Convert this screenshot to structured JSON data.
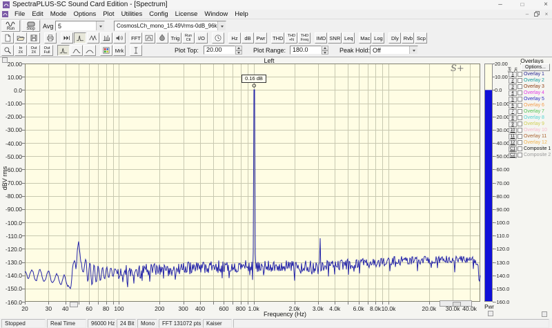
{
  "window": {
    "title": "SpectraPLUS-SC Sound Card Edition - [Spectrum]"
  },
  "menu": {
    "items": [
      "File",
      "Edit",
      "Mode",
      "Options",
      "Plot",
      "Utilities",
      "Config",
      "License",
      "Window",
      "Help"
    ]
  },
  "transport": {
    "run": "Run",
    "stop": "Stop",
    "avg_label": "Avg",
    "avg_value": "5",
    "source_value": "CosmosLCh_mono_15.49Vrms-0dB_96k"
  },
  "toolbar_buttons": [
    {
      "type": "icon",
      "name": "new-document"
    },
    {
      "type": "icon",
      "name": "open-folder"
    },
    {
      "type": "icon",
      "name": "save"
    },
    {
      "type": "gap"
    },
    {
      "type": "icon",
      "name": "print"
    },
    {
      "type": "gap"
    },
    {
      "type": "icon",
      "name": "time-series"
    },
    {
      "type": "icon",
      "name": "spectrum",
      "pressed": true
    },
    {
      "type": "icon",
      "name": "waveform"
    },
    {
      "type": "icon",
      "name": "3d-surface"
    },
    {
      "type": "icon",
      "name": "audio-levels"
    },
    {
      "type": "gap"
    },
    {
      "type": "text",
      "label": "FFT",
      "name": "fft"
    },
    {
      "type": "icon",
      "name": "oscilloscope"
    },
    {
      "type": "icon",
      "name": "spectrogram"
    },
    {
      "type": "text",
      "label": "Trig",
      "name": "trigger"
    },
    {
      "type": "text2",
      "label": "Run|Ctl",
      "name": "run-control"
    },
    {
      "type": "text",
      "label": "I/O",
      "name": "io"
    },
    {
      "type": "gap"
    },
    {
      "type": "icon",
      "name": "clock"
    },
    {
      "type": "gap"
    },
    {
      "type": "text",
      "label": "Hz",
      "name": "hz"
    },
    {
      "type": "text",
      "label": "dB",
      "name": "db"
    },
    {
      "type": "text",
      "label": "Pwr",
      "name": "pwr"
    },
    {
      "type": "gap"
    },
    {
      "type": "text",
      "label": "THD",
      "name": "thd"
    },
    {
      "type": "text2",
      "label": "THD|+N",
      "name": "thd-n"
    },
    {
      "type": "text2",
      "label": "THD|Freq",
      "name": "thd-freq"
    },
    {
      "type": "gap"
    },
    {
      "type": "text",
      "label": "IMD",
      "name": "imd"
    },
    {
      "type": "text",
      "label": "SNR",
      "name": "snr"
    },
    {
      "type": "text",
      "label": "Leq",
      "name": "leq"
    },
    {
      "type": "gap"
    },
    {
      "type": "text",
      "label": "Mac",
      "name": "macro"
    },
    {
      "type": "text",
      "label": "Log",
      "name": "log"
    },
    {
      "type": "gap"
    },
    {
      "type": "text",
      "label": "Dly",
      "name": "delay"
    },
    {
      "type": "text",
      "label": "Rvb",
      "name": "reverb"
    },
    {
      "type": "text",
      "label": "Scp",
      "name": "scope"
    }
  ],
  "zoom_buttons": [
    {
      "type": "icon",
      "name": "magnifier"
    },
    {
      "type": "text2",
      "label": "In|2X",
      "name": "zoom-in-2x"
    },
    {
      "type": "text2",
      "label": "Out|2X",
      "name": "zoom-out-2x"
    },
    {
      "type": "text2",
      "label": "Out|Full",
      "name": "zoom-out-full"
    },
    {
      "type": "gap"
    },
    {
      "type": "icon",
      "name": "peak-narrow",
      "pressed": true
    },
    {
      "type": "icon",
      "name": "peak-medium"
    },
    {
      "type": "icon",
      "name": "peak-wide"
    },
    {
      "type": "gap"
    },
    {
      "type": "icon",
      "name": "legend-colors"
    },
    {
      "type": "text",
      "label": "Mrk",
      "name": "marker"
    },
    {
      "type": "gap"
    },
    {
      "type": "icon",
      "name": "marker-ibeam"
    }
  ],
  "plot_controls": {
    "plot_top_label": "Plot Top:",
    "plot_top_value": "20.00",
    "plot_range_label": "Plot Range:",
    "plot_range_value": "180.0",
    "peak_hold_label": "Peak Hold:",
    "peak_hold_value": "Off"
  },
  "plot": {
    "channel": "Left",
    "logo": "S+",
    "ylabel": "dBV rms",
    "xlabel": "Frequency (Hz)",
    "y_tick_labels": [
      "20.00",
      "10.00",
      "0.0",
      "-10.00",
      "-20.00",
      "-30.00",
      "-40.00",
      "-50.00",
      "-60.00",
      "-70.00",
      "-80.00",
      "-90.00",
      "-100.0",
      "-110.0",
      "-120.0",
      "-130.0",
      "-140.0",
      "-150.0",
      "-160.0"
    ],
    "marker_value": "0.16 dB"
  },
  "meter": {
    "label": "Pwr"
  },
  "overlays": {
    "title": "Overlays",
    "col_sel": "Sel",
    "col_on": "On",
    "options": "Options...",
    "rows": [
      {
        "id": "1",
        "label": "Overlay 1",
        "color": "#1b1b8e"
      },
      {
        "id": "2",
        "label": "Overlay 2",
        "color": "#0e9b9b"
      },
      {
        "id": "3",
        "label": "Overlay 3",
        "color": "#8e3b10"
      },
      {
        "id": "4",
        "label": "Overlay 4",
        "color": "#e23ae2"
      },
      {
        "id": "5",
        "label": "Overlay 5",
        "color": "#2727c3"
      },
      {
        "id": "6",
        "label": "Overlay 6",
        "color": "#f49a4a"
      },
      {
        "id": "7",
        "label": "Overlay 7",
        "color": "#53c353"
      },
      {
        "id": "8",
        "label": "Overlay 8",
        "color": "#4ed3d3"
      },
      {
        "id": "9",
        "label": "Overlay 9",
        "color": "#cfcf52"
      },
      {
        "id": "10",
        "label": "Overlay 10",
        "color": "#f6b8cb"
      },
      {
        "id": "11",
        "label": "Overlay 11",
        "color": "#a8622f"
      },
      {
        "id": "12",
        "label": "Overlay 12",
        "color": "#f0b24e"
      },
      {
        "id": "C1",
        "label": "Composite 1",
        "color": "#111111"
      },
      {
        "id": "C2",
        "label": "Composite 2",
        "color": "#9a9a9a"
      }
    ]
  },
  "statusbar": {
    "sections": [
      "Stopped",
      "Real Time",
      "96000 Hz",
      "24 Bit",
      "Mono",
      "FFT 131072 pts",
      "Kaiser"
    ]
  },
  "chart_data": {
    "type": "line",
    "title": "Left",
    "xlabel": "Frequency (Hz)",
    "ylabel": "dBV rms",
    "x_scale": "log",
    "x_range_hz": [
      20,
      48000
    ],
    "y_range_db": [
      -160,
      20
    ],
    "y_tick_step_db": 10,
    "x_tick_labels": [
      [
        20,
        "20"
      ],
      [
        30,
        "30"
      ],
      [
        40,
        "40"
      ],
      [
        60,
        "60"
      ],
      [
        80,
        "80"
      ],
      [
        100,
        "100"
      ],
      [
        200,
        "200"
      ],
      [
        300,
        "300"
      ],
      [
        400,
        "400"
      ],
      [
        600,
        "600"
      ],
      [
        800,
        "800"
      ],
      [
        1000,
        "1.0k"
      ],
      [
        2000,
        "2.0k"
      ],
      [
        3000,
        "3.0k"
      ],
      [
        4000,
        "4.0k"
      ],
      [
        6000,
        "6.0k"
      ],
      [
        8000,
        "8.0k"
      ],
      [
        10000,
        "10.0k"
      ],
      [
        20000,
        "20.0k"
      ],
      [
        30000,
        "30.0k"
      ],
      [
        40000,
        "40.0k"
      ]
    ],
    "grid_multiples": [
      2,
      3,
      4,
      5,
      6,
      7,
      8,
      9,
      10
    ],
    "trace_color": "#2323a8",
    "plot_bg": "#fffde4",
    "grid_color": "#c8c8b0",
    "meter_bar_color": "#0f0fd8",
    "low_band_points_hz_db": [
      [
        20,
        -137
      ],
      [
        21.2,
        -142
      ],
      [
        22.5,
        -136
      ],
      [
        24.2,
        -144
      ],
      [
        25.9,
        -136
      ],
      [
        27.8,
        -145
      ],
      [
        29.9,
        -137
      ],
      [
        32.1,
        -146
      ],
      [
        34.5,
        -139
      ],
      [
        37,
        -147
      ],
      [
        39.2,
        -140
      ],
      [
        41.6,
        -148
      ],
      [
        43.7,
        -150
      ],
      [
        45.8,
        -131
      ],
      [
        46.9,
        -129
      ],
      [
        48,
        -136
      ],
      [
        49.2,
        -120
      ],
      [
        50.1,
        -114
      ],
      [
        50.9,
        -120
      ],
      [
        52.1,
        -130
      ],
      [
        54,
        -138
      ],
      [
        56.7,
        -128
      ],
      [
        58.7,
        -145
      ],
      [
        60.8,
        -130
      ],
      [
        63,
        -148
      ],
      [
        65.3,
        -132
      ],
      [
        67.7,
        -146
      ],
      [
        70.1,
        -133
      ],
      [
        72.7,
        -144
      ],
      [
        75.4,
        -134
      ],
      [
        78.1,
        -143
      ],
      [
        81,
        -134
      ],
      [
        83.9,
        -142
      ],
      [
        87,
        -134
      ],
      [
        90.2,
        -141
      ],
      [
        93.5,
        -135
      ],
      [
        98.1,
        -139
      ]
    ],
    "noise_floor_hz_db": [
      [
        98,
        -138
      ],
      [
        200,
        -136
      ],
      [
        400,
        -134
      ],
      [
        800,
        -133
      ],
      [
        3000,
        -133
      ],
      [
        6000,
        -131
      ],
      [
        12000,
        -129
      ],
      [
        25000,
        -128
      ],
      [
        43000,
        -128
      ],
      [
        45500,
        -131
      ],
      [
        48000,
        -141
      ]
    ],
    "noise_spread_hz_db": [
      [
        98,
        11
      ],
      [
        300,
        10
      ],
      [
        1000,
        9
      ],
      [
        5000,
        8
      ],
      [
        20000,
        6
      ],
      [
        43000,
        5
      ],
      [
        48000,
        3
      ]
    ],
    "peaks": [
      {
        "hz": 1000,
        "db": 0.16,
        "marker": "0.16 dB"
      },
      {
        "hz": 3100,
        "db": -112
      }
    ],
    "meter_level_db": 0
  }
}
